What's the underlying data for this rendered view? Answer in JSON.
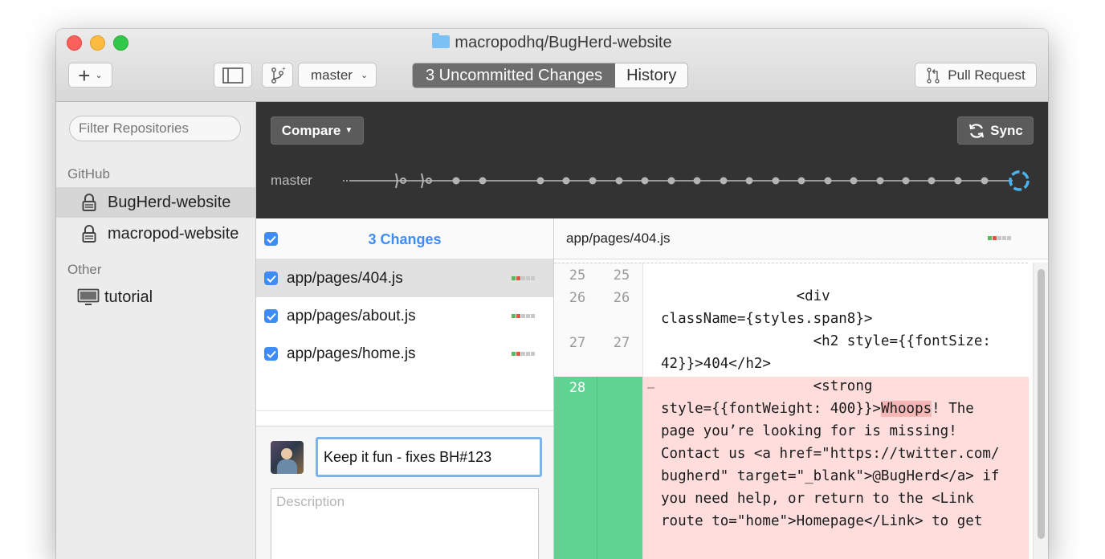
{
  "window": {
    "title": "macropodhq/BugHerd-website"
  },
  "toolbar": {
    "add_label": "+",
    "branch_name": "master",
    "tabs": [
      {
        "label": "3 Uncommitted Changes",
        "active": true
      },
      {
        "label": "History",
        "active": false
      }
    ],
    "pull_request_label": "Pull Request"
  },
  "sidebar": {
    "filter_placeholder": "Filter Repositories",
    "sections": [
      {
        "title": "GitHub",
        "items": [
          {
            "label": "BugHerd-website",
            "selected": true,
            "icon": "lock-icon"
          },
          {
            "label": "macropod-website",
            "selected": false,
            "icon": "lock-icon"
          }
        ]
      },
      {
        "title": "Other",
        "items": [
          {
            "label": "tutorial",
            "selected": false,
            "icon": "monitor-icon"
          }
        ]
      }
    ]
  },
  "header": {
    "compare_label": "Compare",
    "sync_label": "Sync",
    "branch_label": "master"
  },
  "changes": {
    "title": "3 Changes",
    "files": [
      {
        "name": "app/pages/404.js",
        "checked": true,
        "selected": true
      },
      {
        "name": "app/pages/about.js",
        "checked": true,
        "selected": false
      },
      {
        "name": "app/pages/home.js",
        "checked": true,
        "selected": false
      }
    ]
  },
  "commit": {
    "summary_value": "Keep it fun - fixes BH#123",
    "description_placeholder": "Description"
  },
  "diff": {
    "path": "app/pages/404.js",
    "line_numbers": [
      {
        "old": "25",
        "new": "25"
      },
      {
        "old": "26",
        "new": "26"
      },
      {
        "old": "27",
        "new": "27"
      },
      {
        "old": "28",
        "new": ""
      }
    ],
    "removed_marker": "–",
    "lines": [
      "                <div",
      "className={styles.span8}>",
      "                  <h2 style={{fontSize:",
      "42}}>404</h2>",
      "                  <strong",
      "style={{fontWeight: 400}}>",
      "Whoops",
      "! The",
      "page you’re looking for is missing!",
      "Contact us <a href=\"https://twitter.com/",
      "bugherd\" target=\"_blank\">@BugHerd</a> if",
      "you need help, or return to the <Link",
      "route to=\"home\">Homepage</Link> to get"
    ]
  },
  "colors": {
    "accent": "#3e8cf7",
    "removed_bg": "#ffdddd",
    "removed_gutter": "#5fd391",
    "highlight": "#f7b6b6",
    "dark_header": "#333333"
  }
}
